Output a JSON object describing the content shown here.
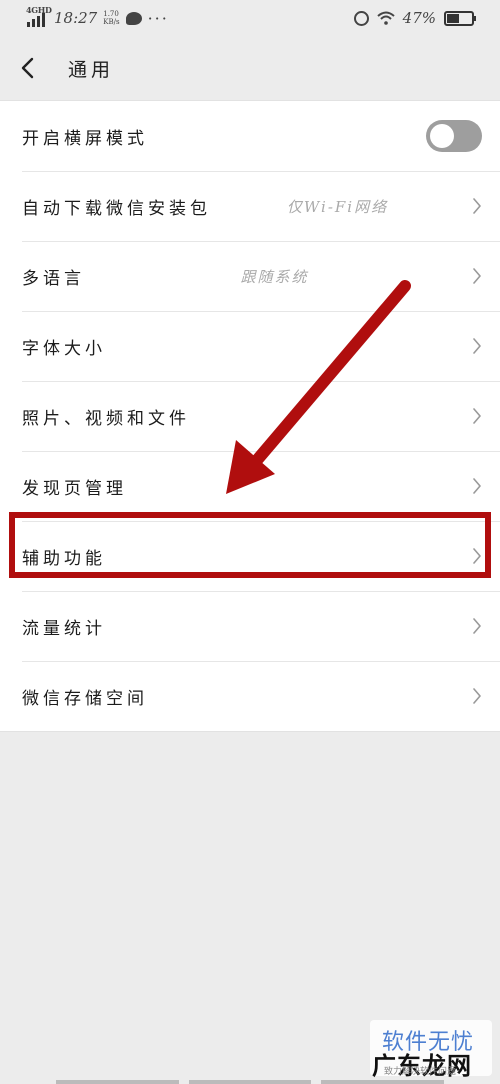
{
  "status_bar": {
    "network": "4GHD",
    "time": "18:27",
    "speed_value": "1.70",
    "speed_unit": "KB/s",
    "battery": "47%",
    "more": "···"
  },
  "nav": {
    "title": "通用",
    "back_icon": "chevron-left-icon"
  },
  "settings": [
    {
      "label": "开启横屏模式",
      "type": "toggle",
      "on": false
    },
    {
      "label": "自动下载微信安装包",
      "value": "仅Wi-Fi网络",
      "type": "link"
    },
    {
      "label": "多语言",
      "value": "跟随系统",
      "type": "link"
    },
    {
      "label": "字体大小",
      "value": "",
      "type": "link"
    },
    {
      "label": "照片、视频和文件",
      "value": "",
      "type": "link"
    },
    {
      "label": "发现页管理",
      "value": "",
      "type": "link"
    },
    {
      "label": "辅助功能",
      "value": "",
      "type": "link",
      "highlighted": true
    },
    {
      "label": "流量统计",
      "value": "",
      "type": "link"
    },
    {
      "label": "微信存储空间",
      "value": "",
      "type": "link"
    }
  ],
  "annotation": {
    "color": "#b00e0e",
    "arrow_target": "辅助功能"
  },
  "watermark": {
    "line1": "软件无忧",
    "line2": "广东龙网",
    "sub": "致力解决软件问题"
  },
  "colors": {
    "background": "#ececec",
    "list_bg": "#ffffff",
    "toggle_off": "#9e9e9e",
    "value_text": "#aaaaaa"
  }
}
